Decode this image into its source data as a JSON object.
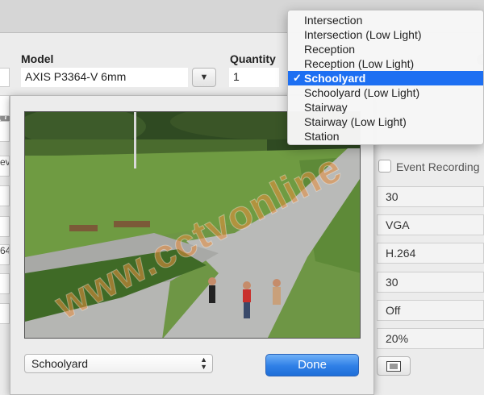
{
  "window": {
    "model_header": "Model",
    "quantity_header": "Quantity",
    "model_value": "AXIS P3364-V 6mm",
    "quantity_value": "1",
    "left_strips": [
      "",
      "",
      "ev",
      "",
      "",
      "64",
      "",
      ""
    ],
    "right_fields": [
      "30",
      "VGA",
      "H.264",
      "30",
      "Off",
      "20%"
    ],
    "event_recording_label": "Event Recording"
  },
  "sheet": {
    "watermark": "www.cctvonline",
    "scene_value": "Schoolyard",
    "done_label": "Done"
  },
  "menu": {
    "items": [
      {
        "label": "Intersection",
        "selected": false
      },
      {
        "label": "Intersection (Low Light)",
        "selected": false
      },
      {
        "label": "Reception",
        "selected": false
      },
      {
        "label": "Reception (Low Light)",
        "selected": false
      },
      {
        "label": "Schoolyard",
        "selected": true
      },
      {
        "label": "Schoolyard (Low Light)",
        "selected": false
      },
      {
        "label": "Stairway",
        "selected": false
      },
      {
        "label": "Stairway (Low Light)",
        "selected": false
      },
      {
        "label": "Station",
        "selected": false
      }
    ],
    "check_glyph": "✓",
    "selection_color": "#1d6ff2"
  },
  "colors": {
    "done_button": "#2f7fe6",
    "watermark": "#e88c3c"
  }
}
